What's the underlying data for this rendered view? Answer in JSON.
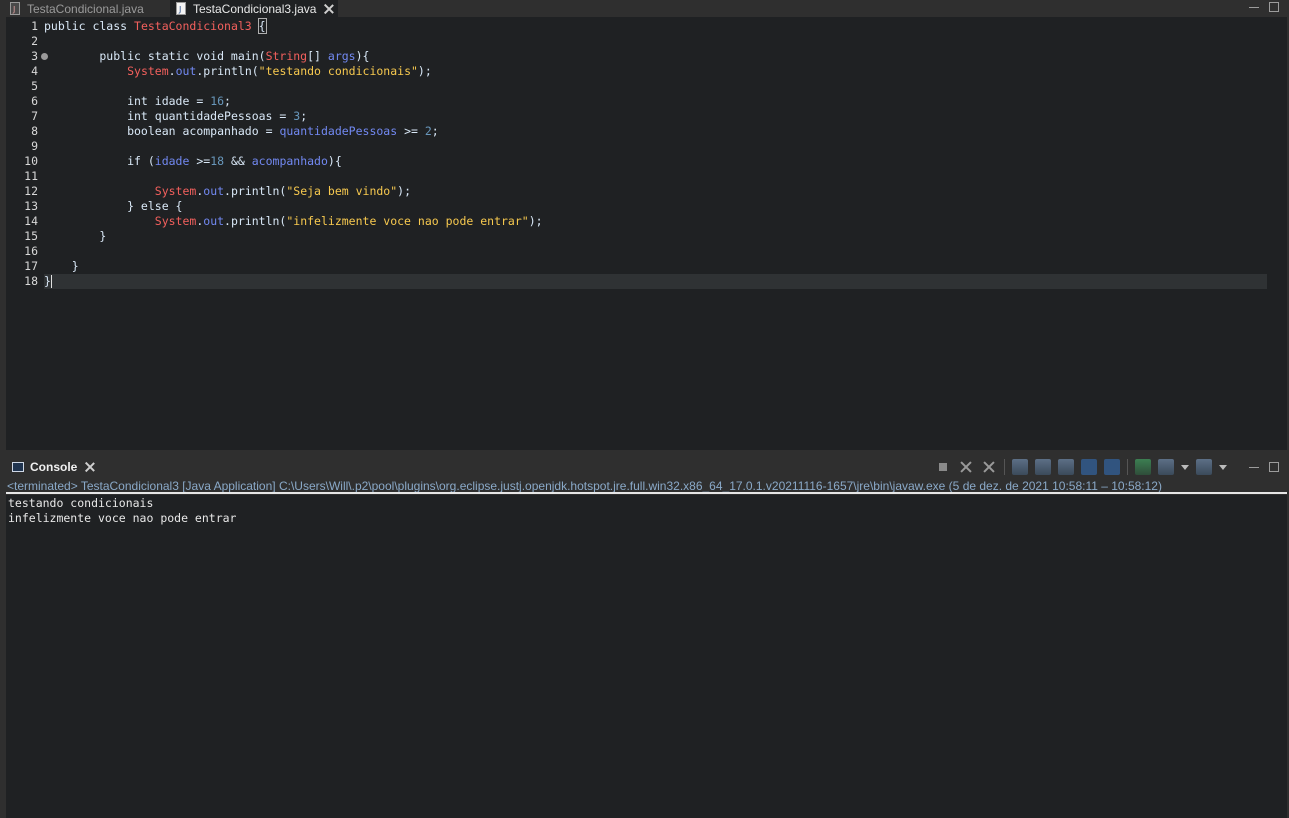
{
  "editor_tabs": [
    {
      "label": "TestaCondicional.java",
      "active": false
    },
    {
      "label": "TestaCondicional3.java",
      "active": true
    }
  ],
  "editor": {
    "line_numbers": [
      "1",
      "2",
      "3",
      "4",
      "5",
      "6",
      "7",
      "8",
      "9",
      "10",
      "11",
      "12",
      "13",
      "14",
      "15",
      "16",
      "17",
      "18"
    ],
    "lines": [
      [
        {
          "t": "public class ",
          "c": "plain"
        },
        {
          "t": "TestaCondicional3",
          "c": "cls"
        },
        {
          "t": " ",
          "c": "plain"
        },
        {
          "t": "{",
          "c": "plain",
          "box": true
        }
      ],
      [],
      [
        {
          "t": "        public static void main(",
          "c": "plain"
        },
        {
          "t": "String",
          "c": "cls"
        },
        {
          "t": "[] ",
          "c": "plain"
        },
        {
          "t": "args",
          "c": "var"
        },
        {
          "t": "){",
          "c": "plain"
        }
      ],
      [
        {
          "t": "            ",
          "c": "plain"
        },
        {
          "t": "System",
          "c": "cls"
        },
        {
          "t": ".",
          "c": "plain"
        },
        {
          "t": "out",
          "c": "var"
        },
        {
          "t": ".println(",
          "c": "plain"
        },
        {
          "t": "\"testando condicionais\"",
          "c": "str2"
        },
        {
          "t": ");",
          "c": "plain"
        }
      ],
      [],
      [
        {
          "t": "            int ",
          "c": "plain"
        },
        {
          "t": "idade",
          "c": "plain"
        },
        {
          "t": " = ",
          "c": "plain"
        },
        {
          "t": "16",
          "c": "num"
        },
        {
          "t": ";",
          "c": "plain"
        }
      ],
      [
        {
          "t": "            int ",
          "c": "plain"
        },
        {
          "t": "quantidadePessoas",
          "c": "plain"
        },
        {
          "t": " = ",
          "c": "plain"
        },
        {
          "t": "3",
          "c": "num"
        },
        {
          "t": ";",
          "c": "plain"
        }
      ],
      [
        {
          "t": "            boolean ",
          "c": "plain"
        },
        {
          "t": "acompanhado",
          "c": "plain"
        },
        {
          "t": " = ",
          "c": "plain"
        },
        {
          "t": "quantidadePessoas",
          "c": "var"
        },
        {
          "t": " >= ",
          "c": "plain"
        },
        {
          "t": "2",
          "c": "num"
        },
        {
          "t": ";",
          "c": "plain"
        }
      ],
      [],
      [
        {
          "t": "            if (",
          "c": "plain"
        },
        {
          "t": "idade",
          "c": "var"
        },
        {
          "t": " >=",
          "c": "plain"
        },
        {
          "t": "18",
          "c": "num"
        },
        {
          "t": " && ",
          "c": "plain"
        },
        {
          "t": "acompanhado",
          "c": "var"
        },
        {
          "t": "){",
          "c": "plain"
        }
      ],
      [],
      [
        {
          "t": "                ",
          "c": "plain"
        },
        {
          "t": "System",
          "c": "cls"
        },
        {
          "t": ".",
          "c": "plain"
        },
        {
          "t": "out",
          "c": "var"
        },
        {
          "t": ".println(",
          "c": "plain"
        },
        {
          "t": "\"Seja bem vindo\"",
          "c": "str2"
        },
        {
          "t": ");",
          "c": "plain"
        }
      ],
      [
        {
          "t": "            } else {",
          "c": "plain"
        }
      ],
      [
        {
          "t": "                ",
          "c": "plain"
        },
        {
          "t": "System",
          "c": "cls"
        },
        {
          "t": ".",
          "c": "plain"
        },
        {
          "t": "out",
          "c": "var"
        },
        {
          "t": ".println(",
          "c": "plain"
        },
        {
          "t": "\"infelizmente voce nao pode entrar\"",
          "c": "str2"
        },
        {
          "t": ");",
          "c": "plain"
        }
      ],
      [
        {
          "t": "        }",
          "c": "plain"
        }
      ],
      [],
      [
        {
          "t": "    }",
          "c": "plain"
        }
      ],
      [
        {
          "t": "}",
          "c": "plain"
        }
      ]
    ],
    "fold_marker_line": 3,
    "current_line": 18
  },
  "console": {
    "tab_label": "Console",
    "status": "<terminated> TestaCondicional3 [Java Application] C:\\Users\\Will\\.p2\\pool\\plugins\\org.eclipse.justj.openjdk.hotspot.jre.full.win32.x86_64_17.0.1.v20211116-1657\\jre\\bin\\javaw.exe  (5 de dez. de 2021 10:58:11 – 10:58:12)",
    "output": [
      "testando condicionais",
      "infelizmente voce nao pode entrar"
    ],
    "toolbar_icons": [
      "terminate-icon",
      "remove-launch-icon",
      "remove-all-terminated-icon",
      "scroll-lock-icon",
      "word-wrap-icon",
      "show-console-on-output-icon",
      "show-console-on-error-icon",
      "pin-console-icon",
      "display-selected-console-icon",
      "open-console-icon"
    ]
  }
}
